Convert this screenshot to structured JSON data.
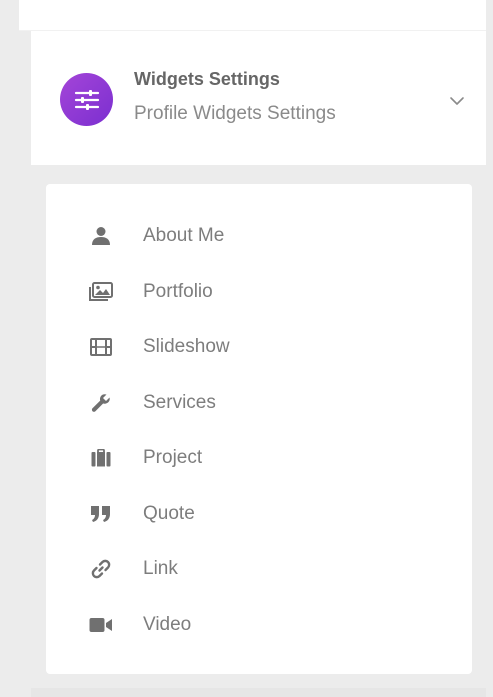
{
  "header": {
    "title": "Widgets Settings",
    "subtitle": "Profile Widgets Settings",
    "avatar_icon": "sliders-icon",
    "accent_color": "#8e3ad5"
  },
  "menu": {
    "items": [
      {
        "label": "About Me",
        "icon": "user-icon"
      },
      {
        "label": "Portfolio",
        "icon": "images-icon"
      },
      {
        "label": "Slideshow",
        "icon": "film-icon"
      },
      {
        "label": "Services",
        "icon": "wrench-icon"
      },
      {
        "label": "Project",
        "icon": "briefcase-icon"
      },
      {
        "label": "Quote",
        "icon": "quote-icon"
      },
      {
        "label": "Link",
        "icon": "link-icon"
      },
      {
        "label": "Video",
        "icon": "video-icon"
      }
    ]
  }
}
